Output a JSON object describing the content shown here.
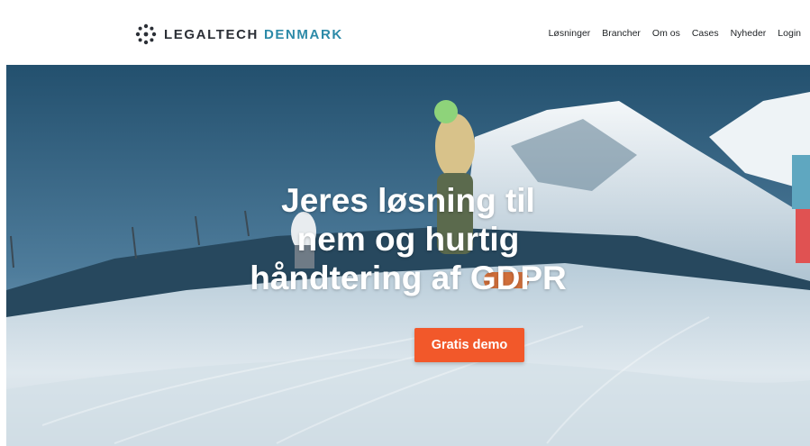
{
  "header": {
    "logo": {
      "word1": "LEGALTECH",
      "word2": "DENMARK",
      "icon": "circular-dots-logo-icon"
    },
    "nav": [
      "Løsninger",
      "Brancher",
      "Om os",
      "Cases",
      "Nyheder",
      "Login"
    ]
  },
  "hero": {
    "headline": [
      "Jeres løsning til",
      "nem og hurtig",
      "håndtering af GDPR"
    ],
    "cta_label": "Gratis demo"
  },
  "colors": {
    "brand_dark": "#2b2f36",
    "brand_accent": "#2c8aa8",
    "cta": "#f2582a"
  }
}
